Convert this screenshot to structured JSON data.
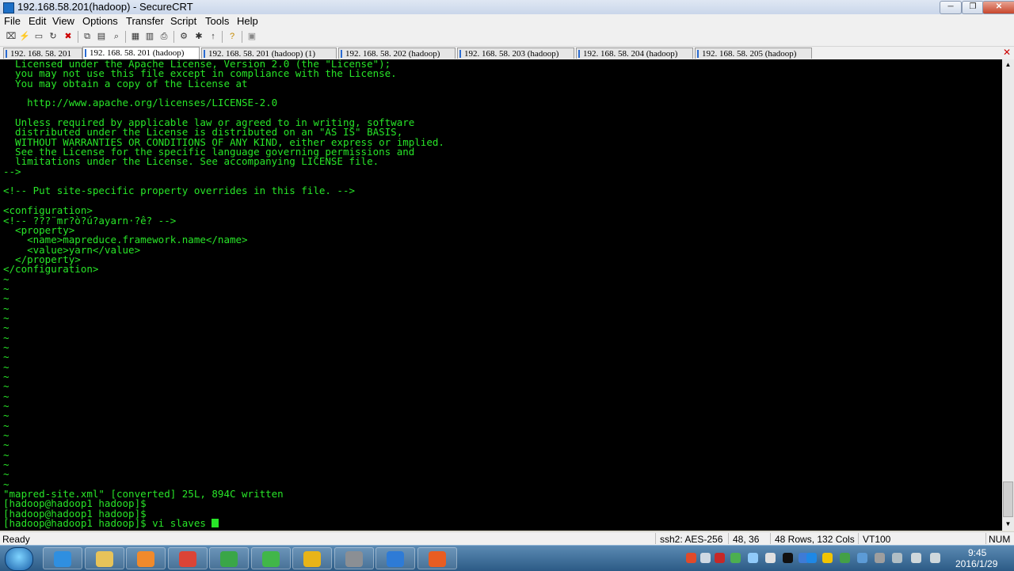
{
  "window": {
    "title": "192.168.58.201(hadoop) - SecureCRT",
    "minimize": "─",
    "maximize": "❐",
    "close": "✕"
  },
  "menu": [
    "File",
    "Edit",
    "View",
    "Options",
    "Transfer",
    "Script",
    "Tools",
    "Help"
  ],
  "toolbar_icons": [
    "connect-icon",
    "quick-connect-icon",
    "connect-tab-icon",
    "reconnect-icon",
    "disconnect-icon",
    "copy-icon",
    "paste-icon",
    "copy-paste-icon",
    "find-icon",
    "print-icon",
    "print-selection-icon",
    "print-setup-icon",
    "session-options-icon",
    "global-options-icon",
    "keymap-icon",
    "help-icon",
    "about-icon"
  ],
  "tabs": [
    {
      "label": "192. 168. 58. 201",
      "active": false
    },
    {
      "label": "192. 168. 58. 201 (hadoop)",
      "active": true
    },
    {
      "label": "192. 168. 58. 201 (hadoop)  (1)",
      "active": false
    },
    {
      "label": "192. 168. 58. 202 (hadoop)",
      "active": false
    },
    {
      "label": "192. 168. 58. 203 (hadoop)",
      "active": false
    },
    {
      "label": "192. 168. 58. 204 (hadoop)",
      "active": false
    },
    {
      "label": "192. 168. 58. 205 (hadoop)",
      "active": false
    }
  ],
  "tab_close": "✕",
  "terminal": {
    "lines": [
      "  Licensed under the Apache License, Version 2.0 (the \"License\");",
      "  you may not use this file except in compliance with the License.",
      "  You may obtain a copy of the License at",
      "",
      "    http://www.apache.org/licenses/LICENSE-2.0",
      "",
      "  Unless required by applicable law or agreed to in writing, software",
      "  distributed under the License is distributed on an \"AS IS\" BASIS,",
      "  WITHOUT WARRANTIES OR CONDITIONS OF ANY KIND, either express or implied.",
      "  See the License for the specific language governing permissions and",
      "  limitations under the License. See accompanying LICENSE file.",
      "-->",
      "",
      "<!-- Put site-specific property overrides in this file. -->",
      "",
      "<configuration>",
      "<!-- ???¨mr?ò?ú?ayarn·?ê? -->",
      "  <property>",
      "    <name>mapreduce.framework.name</name>",
      "    <value>yarn</value>",
      "  </property>",
      "</configuration>",
      "~",
      "~",
      "~",
      "~",
      "~",
      "~",
      "~",
      "~",
      "~",
      "~",
      "~",
      "~",
      "~",
      "~",
      "~",
      "~",
      "~",
      "~",
      "~",
      "~",
      "~",
      "~",
      "\"mapred-site.xml\" [converted] 25L, 894C written",
      "[hadoop@hadoop1 hadoop]$",
      "[hadoop@hadoop1 hadoop]$",
      "[hadoop@hadoop1 hadoop]$ vi slaves "
    ],
    "cursor_line": 47
  },
  "status": {
    "ready": "Ready",
    "cipher": "ssh2: AES-256",
    "position": "48,  36",
    "size": "48 Rows, 132 Cols",
    "emulation": "VT100",
    "num": "NUM"
  },
  "taskbar": {
    "apps": [
      {
        "name": "internet-explorer-icon",
        "color": "#2f8fe0"
      },
      {
        "name": "file-explorer-icon",
        "color": "#e7c35a"
      },
      {
        "name": "media-player-icon",
        "color": "#f08a2c"
      },
      {
        "name": "chrome-icon",
        "color": "#db4437"
      },
      {
        "name": "securefx-icon",
        "color": "#3aa648"
      },
      {
        "name": "green-browser-icon",
        "color": "#41b649"
      },
      {
        "name": "editor-e-icon",
        "color": "#e8b419"
      },
      {
        "name": "printer-app-icon",
        "color": "#8b8f94"
      },
      {
        "name": "securecrt-icon",
        "color": "#2e7bd6"
      },
      {
        "name": "tiger-game-icon",
        "color": "#e85d22"
      }
    ],
    "time": "9:45",
    "date": "2016/1/29"
  },
  "colors": {
    "terminal_text": "#28e528",
    "terminal_bg": "#000000"
  }
}
